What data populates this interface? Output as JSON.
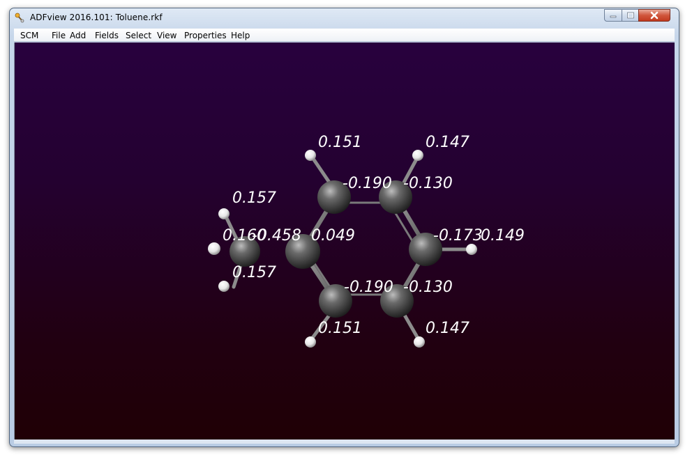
{
  "window": {
    "title": "ADFview 2016.101: Toluene.rkf"
  },
  "menu": {
    "items": [
      "SCM",
      "File",
      "Add",
      "Fields",
      "Select",
      "View",
      "Properties",
      "Help"
    ]
  },
  "icons": {
    "app": "app-icon",
    "minimize": "minimize-icon",
    "maximize": "maximize-icon",
    "close": "close-icon"
  },
  "colors": {
    "background_top": "#28013e",
    "background_bottom": "#200005",
    "carbon": "#4a4a4a",
    "hydrogen": "#ffffff",
    "label": "#ffffff"
  },
  "molecule": {
    "atoms": [
      {
        "id": "C1",
        "element": "C",
        "charge": "-0.458"
      },
      {
        "id": "C2",
        "element": "C",
        "charge": "0.049"
      },
      {
        "id": "C3",
        "element": "C",
        "charge": "-0.190"
      },
      {
        "id": "C4",
        "element": "C",
        "charge": "-0.130"
      },
      {
        "id": "C5",
        "element": "C",
        "charge": "-0.173"
      },
      {
        "id": "C6",
        "element": "C",
        "charge": "-0.130"
      },
      {
        "id": "C7",
        "element": "C",
        "charge": "-0.190"
      },
      {
        "id": "H1",
        "element": "H",
        "charge": "0.157"
      },
      {
        "id": "H2",
        "element": "H",
        "charge": "0.160"
      },
      {
        "id": "H3",
        "element": "H",
        "charge": "0.157"
      },
      {
        "id": "H4",
        "element": "H",
        "charge": "0.151"
      },
      {
        "id": "H5",
        "element": "H",
        "charge": "0.147"
      },
      {
        "id": "H6",
        "element": "H",
        "charge": "0.149"
      },
      {
        "id": "H7",
        "element": "H",
        "charge": "0.147"
      },
      {
        "id": "H8",
        "element": "H",
        "charge": "0.151"
      }
    ]
  }
}
